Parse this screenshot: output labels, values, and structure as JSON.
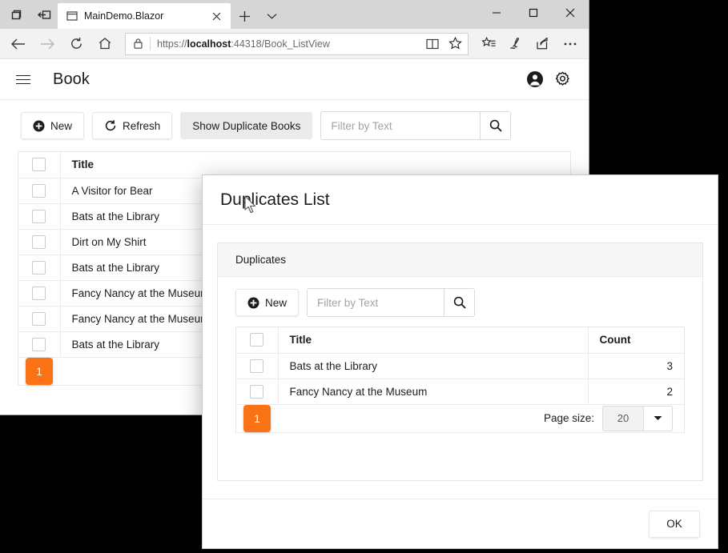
{
  "browser": {
    "left_icons": [
      {
        "name": "tab-preview-icon"
      },
      {
        "name": "set-aside-tabs-icon"
      }
    ],
    "tab": {
      "title": "MainDemo.Blazor",
      "favicon_name": "page-icon",
      "close_label": "✕"
    },
    "new_tab_label": "+",
    "tab_menu_label": "⌄",
    "window_controls": {
      "minimize": "–",
      "maximize": "□",
      "close": "✕"
    },
    "nav": {
      "back": "←",
      "forward": "→",
      "refresh": "↻",
      "home": "⌂"
    },
    "address": {
      "scheme": "https://",
      "host": "localhost",
      "rest": ":44318/Book_ListView",
      "full": "https://localhost:44318/Book_ListView",
      "lock_icon": "padlock-icon",
      "reading_view_icon": "reading-view-icon",
      "favorite_icon": "star-icon"
    },
    "toolbar_right": [
      {
        "name": "favorites-hub-icon"
      },
      {
        "name": "web-notes-icon"
      },
      {
        "name": "share-icon"
      },
      {
        "name": "more-options-icon"
      }
    ]
  },
  "app": {
    "header": {
      "menu_label": "menu",
      "title": "Book",
      "account_icon": "account-icon",
      "settings_icon": "gear-icon"
    },
    "toolbar": {
      "new_label": "New",
      "refresh_label": "Refresh",
      "show_duplicates_label": "Show Duplicate Books",
      "filter_placeholder": "Filter by Text",
      "filter_value": "",
      "search_icon": "search-icon"
    },
    "grid": {
      "columns": [
        "Title"
      ],
      "rows": [
        {
          "title": "A Visitor for Bear"
        },
        {
          "title": "Bats at the Library"
        },
        {
          "title": "Dirt on My Shirt"
        },
        {
          "title": "Bats at the Library"
        },
        {
          "title": "Fancy Nancy at the Museum"
        },
        {
          "title": "Fancy Nancy at the Museum"
        },
        {
          "title": "Bats at the Library"
        }
      ],
      "current_page": "1"
    }
  },
  "dialog": {
    "title": "Duplicates List",
    "panel_title": "Duplicates",
    "toolbar": {
      "new_label": "New",
      "filter_placeholder": "Filter by Text",
      "filter_value": "",
      "search_icon": "search-icon"
    },
    "grid": {
      "columns": [
        "Title",
        "Count"
      ],
      "rows": [
        {
          "title": "Bats at the Library",
          "count": "3"
        },
        {
          "title": "Fancy Nancy at the Museum",
          "count": "2"
        }
      ],
      "current_page": "1",
      "page_size_label": "Page size:",
      "page_size_value": "20"
    },
    "ok_label": "OK"
  },
  "colors": {
    "accent_orange": "#f97316",
    "text": "#1c1c1c",
    "chrome_tabstrip": "#d6d6d6",
    "chrome_navbar": "#f2f2f2",
    "desktop": "#000000"
  }
}
